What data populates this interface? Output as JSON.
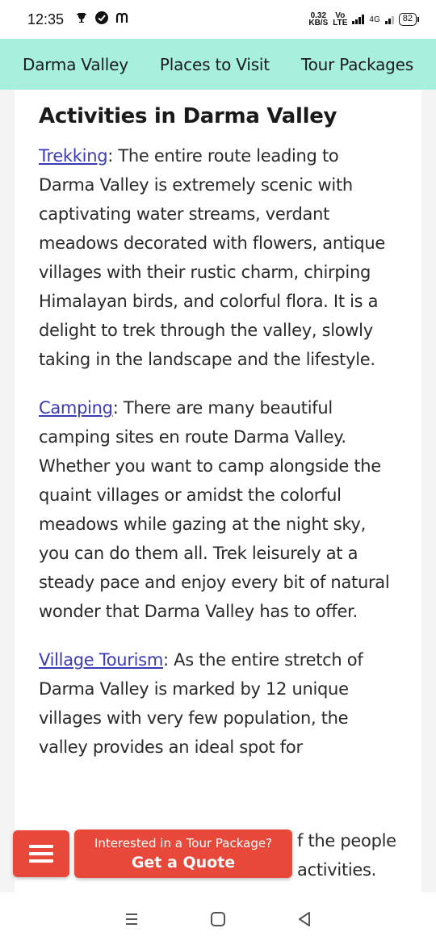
{
  "status": {
    "time": "12:35",
    "net_speed_value": "0.32",
    "net_speed_unit": "KB/S",
    "volte": "Vo",
    "lte": "LTE",
    "network": "4G",
    "battery": "82"
  },
  "nav": {
    "items": [
      {
        "label": "Darma Valley"
      },
      {
        "label": "Places to Visit"
      },
      {
        "label": "Tour Packages"
      }
    ]
  },
  "article": {
    "heading": "Activities in Darma Valley",
    "sections": [
      {
        "link": "Trekking",
        "text": ": The entire route leading to Darma Valley is extremely scenic with captivating water streams, verdant meadows decorated with flowers, antique villages with their rustic charm, chirping Himalayan birds, and colorful flora. It is a delight to trek through the valley, slowly taking in the landscape and the lifestyle."
      },
      {
        "link": "Camping",
        "text": ": There are many beautiful camping sites en route Darma Valley. Whether you want to camp alongside the quaint villages or amidst the colorful meadows while gazing at the night sky, you can do them all. Trek leisurely at a steady pace and enjoy every bit of natural wonder that Darma Valley has to offer."
      },
      {
        "link": "Village Tourism",
        "text": ": As the entire stretch of Darma Valley is marked by 12 unique villages with very few population, the valley provides an ideal spot for"
      },
      {
        "link": "",
        "text": "f the people activities."
      }
    ]
  },
  "cta": {
    "subtitle": "Interested in a Tour Package?",
    "title": "Get a Quote"
  },
  "icons": {
    "menu": "hamburger-menu-icon",
    "recents": "recents-icon",
    "home": "home-icon",
    "back": "back-icon"
  },
  "colors": {
    "nav_bg": "#a6f0dd",
    "accent": "#e8483a",
    "link": "#3b3bb5"
  }
}
